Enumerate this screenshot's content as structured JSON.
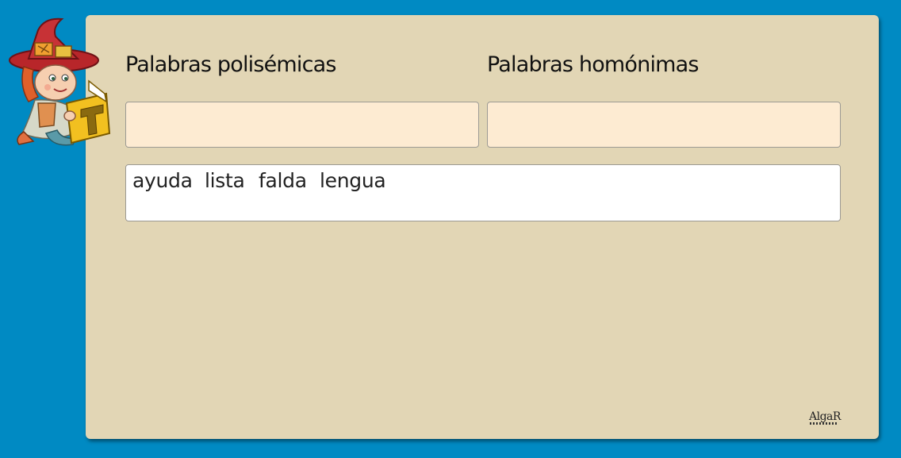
{
  "columns": {
    "left_title": "Palabras polisémicas",
    "right_title": "Palabras homónimas"
  },
  "word_bank": {
    "words": [
      "ayuda",
      "lista",
      "falda",
      "lengua"
    ]
  },
  "mascot": {
    "icon": "witch-reading-book-icon",
    "book_letter": "T"
  },
  "logo": {
    "text": "AlgaR"
  },
  "colors": {
    "background": "#008ac3",
    "card": "#e2d6b5",
    "drop_zone": "#fdebd2",
    "word_bank": "#ffffff"
  }
}
